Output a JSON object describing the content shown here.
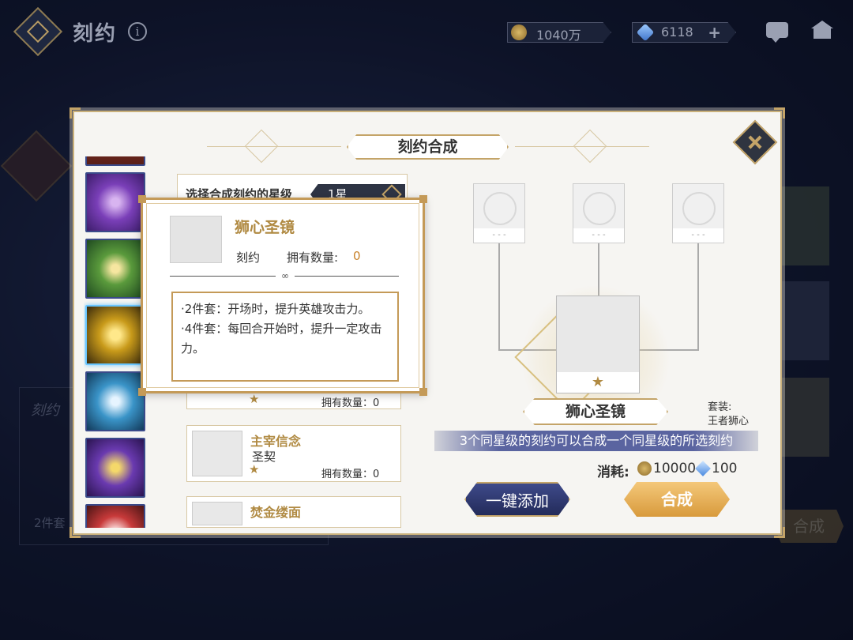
{
  "topbar": {
    "title": "刻约",
    "info_icon": "info-icon",
    "gold": "1040万",
    "gems": "6118",
    "gems_plus": "+"
  },
  "background": {
    "left_card_title": "刻约",
    "left_card_text": "2件套"
  },
  "dialog": {
    "title": "刻约合成",
    "select_label": "选择合成刻约的星级",
    "select_value": "1星",
    "list": [
      {
        "name": "",
        "type": "",
        "owned_label": "拥有数量：0",
        "stars": "★"
      },
      {
        "name": "主宰信念",
        "type": "圣契",
        "owned_label": "拥有数量：0",
        "stars": "★"
      },
      {
        "name": "焚金缕面",
        "type": "",
        "owned_label": "",
        "stars": ""
      }
    ],
    "result": {
      "name": "狮心圣镜",
      "stars": "★",
      "set_label": "套装:",
      "set_value": "王者狮心"
    },
    "hint": "3个同星级的刻约可以合成一个同星级的所选刻约",
    "cost": {
      "label": "消耗:",
      "gold": "10000",
      "gems": "100"
    },
    "slot_placeholder": "- - -",
    "buttons": {
      "auto_add": "一键添加",
      "combine": "合成"
    }
  },
  "popup": {
    "name": "狮心圣镜",
    "type": "刻约",
    "owned_label": "拥有数量:",
    "owned_value": "0",
    "divider": "∞",
    "desc_2": "·2件套：开场时，提升英雄攻击力。",
    "desc_4": "·4件套：每回合开始时，提升一定攻击力。"
  },
  "colors": {
    "gold_accent": "#c4a468",
    "name_gold": "#b08a42",
    "button_blue": "#2e3a72",
    "button_orange": "#e4aa50"
  }
}
